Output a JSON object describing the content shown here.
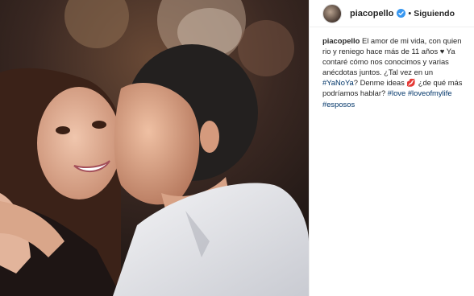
{
  "post": {
    "username": "piacopello",
    "separator": "•",
    "follow_label": "Siguiendo",
    "caption": {
      "part1": "El amor de mi vida, con quien rio y reniego hace más de 11 años",
      "heart": "♥",
      "part2": "Ya contaré cómo nos conocimos y varias anécdotas juntos. ¿Tal vez en un",
      "hashtag1": "#YaNoYa",
      "part3": "? Denme ideas",
      "kiss": "💋",
      "part4": "¿de qué más podríamos hablar?",
      "hashtag2": "#love",
      "hashtag3": "#loveofmylife",
      "hashtag4": "#esposos"
    }
  },
  "colors": {
    "verified": "#3897f0",
    "hashtag": "#003569",
    "text": "#262626",
    "border": "#efefef"
  },
  "icons": {
    "verified": "verified-badge-icon",
    "avatar": "profile-avatar"
  }
}
